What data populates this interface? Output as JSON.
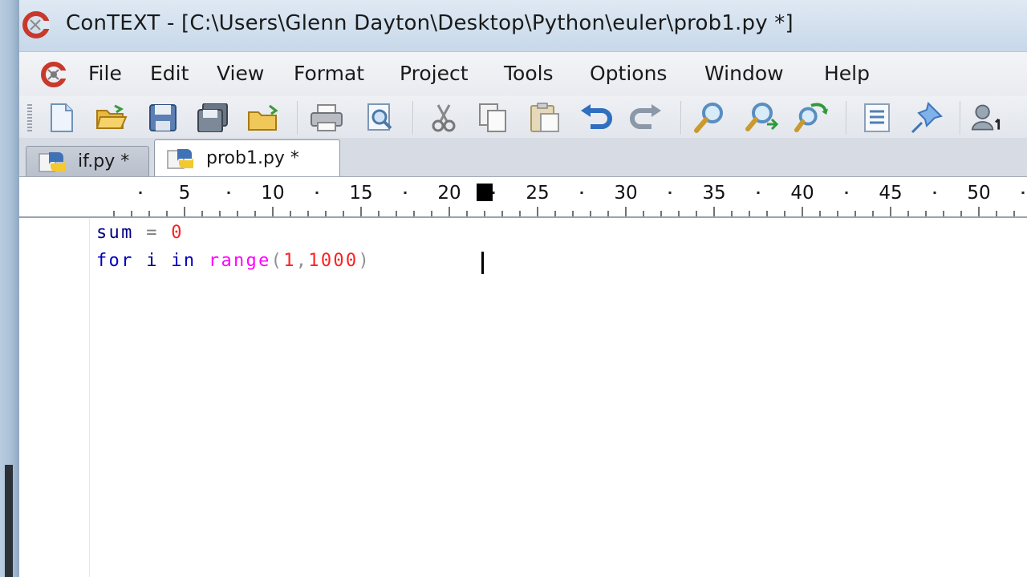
{
  "window": {
    "title": "ConTEXT - [C:\\Users\\Glenn Dayton\\Desktop\\Python\\euler\\prob1.py *]"
  },
  "menu": {
    "items": [
      "File",
      "Edit",
      "View",
      "Format",
      "Project",
      "Tools",
      "Options",
      "Window",
      "Help"
    ]
  },
  "toolbar": {
    "buttons": [
      "new-file-icon",
      "open-folder-icon",
      "save-icon",
      "save-all-icon",
      "open-project-icon",
      "print-icon",
      "print-preview-icon",
      "cut-icon",
      "copy-icon",
      "paste-icon",
      "undo-icon",
      "redo-icon",
      "find-icon",
      "find-next-icon",
      "replace-icon",
      "list-icon",
      "pin-icon",
      "user-icon"
    ]
  },
  "tabs": [
    {
      "label": "if.py *",
      "active": false
    },
    {
      "label": "prob1.py *",
      "active": true
    }
  ],
  "ruler": {
    "labels": [
      "5",
      "10",
      "15",
      "20",
      "25",
      "30",
      "35",
      "40",
      "45",
      "50"
    ],
    "cursor_column": 22
  },
  "editor": {
    "line1": {
      "var": "sum",
      "op": "=",
      "num": "0"
    },
    "line2": {
      "kw1": "for",
      "var": "i",
      "kw2": "in",
      "fn": "range",
      "open": "(",
      "arg1": "1",
      "comma": ",",
      "arg2": "1000",
      "close": ")"
    }
  },
  "colors": {
    "keyword": "#0000c0",
    "number": "#ff2020",
    "function": "#ff00ff",
    "accent": "#c0392b"
  }
}
